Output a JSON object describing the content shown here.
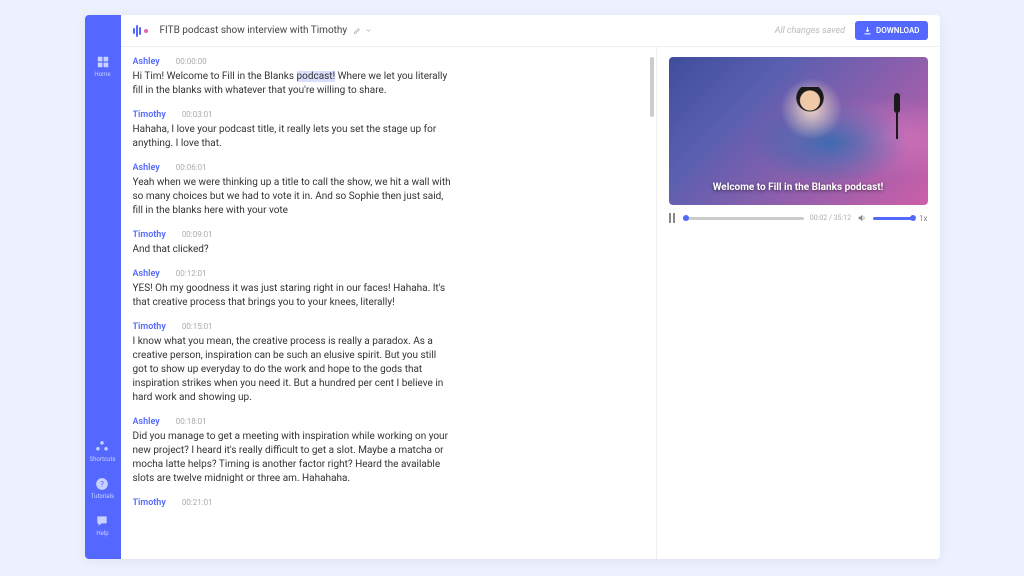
{
  "header": {
    "title": "FITB podcast show interview with Timothy",
    "status": "All changes saved",
    "download_label": "DOWNLOAD"
  },
  "sidebar": {
    "home": "Home",
    "shortcuts": "Shortcuts",
    "tutorials": "Tutorials",
    "help": "Help"
  },
  "video": {
    "caption": "Welcome to Fill in the Blanks podcast!",
    "current_time": "00:02",
    "total_time": "35:12",
    "speed": "1x"
  },
  "transcript": [
    {
      "speaker": "Ashley",
      "time": "00:00:00",
      "text_pre": "Hi Tim! Welcome to Fill in the Blanks ",
      "text_hl": "podcast!",
      "text_post": " Where we let you literally fill in the blanks with whatever that you're willing to share."
    },
    {
      "speaker": "Timothy",
      "time": "00:03:01",
      "text": "Hahaha, I love your podcast title, it really lets you set the stage up for anything. I love that."
    },
    {
      "speaker": "Ashley",
      "time": "00:06:01",
      "text": "Yeah when we were thinking up a title to call the show, we hit a wall with so many choices but we had to vote it in. And so Sophie then just said, fill in the blanks here with your vote"
    },
    {
      "speaker": "Timothy",
      "time": "00:09:01",
      "text": "And that clicked?"
    },
    {
      "speaker": "Ashley",
      "time": "00:12:01",
      "text": "YES! Oh my goodness it was just staring right in our faces! Hahaha. It's that creative process that brings you to your knees, literally!"
    },
    {
      "speaker": "Timothy",
      "time": "00:15:01",
      "text": "I know what you mean, the creative process is really a paradox. As a creative person, inspiration can be such an elusive spirit. But you still got to show up everyday to do the work and hope to the gods that inspiration strikes when you need it. But a hundred per cent I believe in hard work and showing up."
    },
    {
      "speaker": "Ashley",
      "time": "00:18:01",
      "text": "Did you manage to get a meeting with inspiration while working on your new project? I heard it's really difficult to get a slot. Maybe a matcha or mocha latte helps? Timing is another factor right? Heard the available slots are twelve midnight or three am. Hahahaha."
    },
    {
      "speaker": "Timothy",
      "time": "00:21:01",
      "text": ""
    }
  ]
}
